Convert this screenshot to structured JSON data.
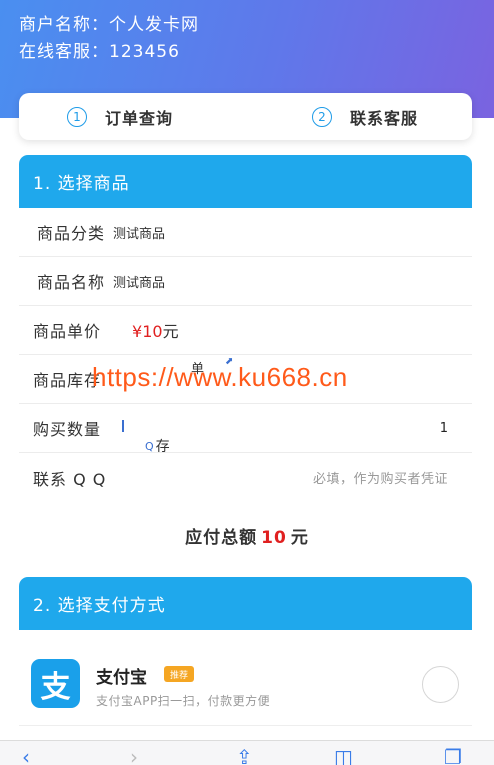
{
  "header": {
    "merchant_line": "商户名称：个人发卡网",
    "service_line": "在线客服：123456"
  },
  "tabs": [
    {
      "num": "1",
      "label": "订单查询"
    },
    {
      "num": "2",
      "label": "联系客服"
    }
  ],
  "section1": {
    "title": "1. 选择商品",
    "category_label": "商品分类",
    "category_value": "测试商品",
    "name_label": "商品名称",
    "name_value": "测试商品",
    "price_label": "商品单价",
    "price_symbol": "¥",
    "price_amount": "10",
    "price_unit": "元",
    "stock_label": "商品库存",
    "stock_widget_text": "单",
    "stock_widget_text2": "存",
    "quantity_label": "购买数量",
    "quantity_value": "1",
    "qq_label": "联系 Q Q",
    "qq_placeholder": "必填，作为购买者凭证"
  },
  "watermark": "https://www.ku668.cn",
  "total": {
    "label": "应付总额",
    "amount": "10",
    "unit": "元"
  },
  "section2": {
    "title": "2. 选择支付方式"
  },
  "payment": {
    "logo_char": "支",
    "name": "支付宝",
    "badge": "推荐",
    "desc": "支付宝APP扫一扫，付款更方便"
  },
  "colors": {
    "accent": "#1fa8ec",
    "price_red": "#e02020",
    "watermark": "#ff5a1a"
  }
}
